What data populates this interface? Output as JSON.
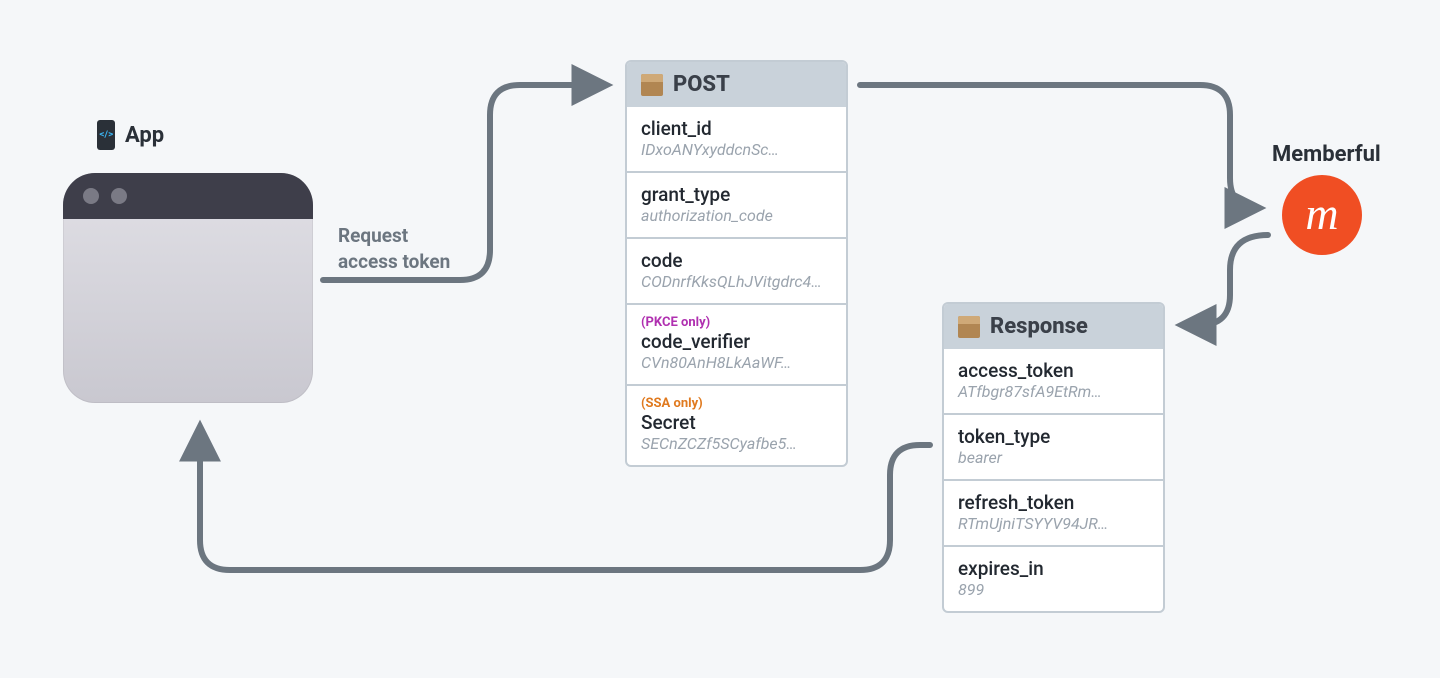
{
  "app": {
    "label": "App"
  },
  "memberful": {
    "label": "Memberful"
  },
  "request_label_line1": "Request",
  "request_label_line2": "access token",
  "post": {
    "title": "POST",
    "fields": [
      {
        "name": "client_id",
        "value": "IDxoANYxyddcnSc…"
      },
      {
        "name": "grant_type",
        "value": "authorization_code"
      },
      {
        "name": "code",
        "value": "CODnrfKksQLhJVitgdrc4…"
      },
      {
        "tag": "(PKCE only)",
        "tag_class": "tag-pkce",
        "name": "code_verifier",
        "value": "CVn80AnH8LkAaWF…"
      },
      {
        "tag": "(SSA only)",
        "tag_class": "tag-ssa",
        "name": "Secret",
        "value": "SECnZCZf5SCyafbe5…"
      }
    ]
  },
  "response": {
    "title": "Response",
    "fields": [
      {
        "name": "access_token",
        "value": "ATfbgr87sfA9EtRm…"
      },
      {
        "name": "token_type",
        "value": "bearer"
      },
      {
        "name": "refresh_token",
        "value": "RTmUjniTSYYV94JR…"
      },
      {
        "name": "expires_in",
        "value": "899"
      }
    ]
  }
}
